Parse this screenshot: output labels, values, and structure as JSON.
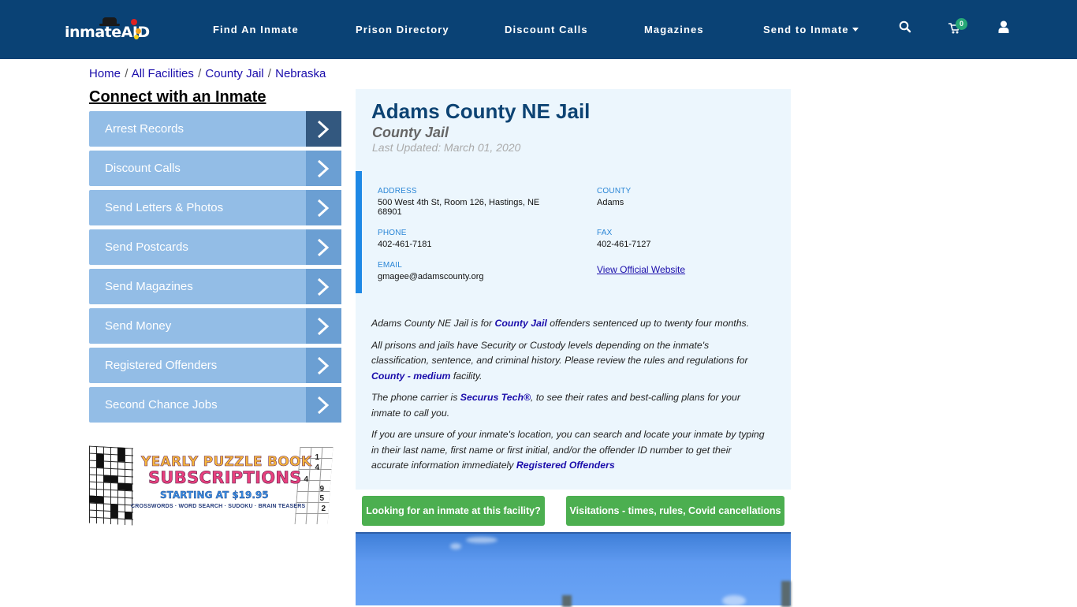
{
  "header": {
    "logo_text": "inmateAID",
    "nav": [
      {
        "label": "Find An Inmate"
      },
      {
        "label": "Prison Directory"
      },
      {
        "label": "Discount Calls"
      },
      {
        "label": "Magazines"
      },
      {
        "label": "Send to Inmate",
        "has_dropdown": true
      }
    ],
    "icons": [
      "search-icon",
      "cart-icon",
      "user-icon"
    ],
    "cart_count": "0"
  },
  "breadcrumb": [
    {
      "label": "Home"
    },
    {
      "label": "All Facilities"
    },
    {
      "label": "County Jail"
    },
    {
      "label": "Nebraska"
    }
  ],
  "breadcrumb_separator": "/",
  "sidebar": {
    "title": "Connect with an Inmate",
    "items": [
      {
        "label": "Arrest Records"
      },
      {
        "label": "Discount Calls"
      },
      {
        "label": "Send Letters & Photos"
      },
      {
        "label": "Send Postcards"
      },
      {
        "label": "Send Magazines"
      },
      {
        "label": "Send Money"
      },
      {
        "label": "Registered Offenders"
      },
      {
        "label": "Second Chance Jobs"
      }
    ],
    "ad": {
      "line1": "YEARLY PUZZLE BOOK",
      "line2": "SUBSCRIPTIONS",
      "line3": "STARTING AT $19.95",
      "line4": "CROSSWORDS · WORD SEARCH · SUDOKU · BRAIN TEASERS",
      "sudoku_numbers": [
        "1",
        "4",
        "4",
        "9",
        "5",
        "2"
      ]
    }
  },
  "facility": {
    "name": "Adams County NE Jail",
    "type": "County Jail",
    "last_updated": "Last Updated: March 01, 2020",
    "address_label": "ADDRESS",
    "address": "500 West 4th St, Room 126, Hastings, NE 68901",
    "county_label": "COUNTY",
    "county": "Adams",
    "phone_label": "PHONE",
    "phone": "402-461-7181",
    "fax_label": "FAX",
    "fax": "402-461-7127",
    "email_label": "EMAIL",
    "email": "gmagee@adamscounty.org",
    "website_link": "View Official Website"
  },
  "description": {
    "p1_pre": "Adams County NE Jail is for ",
    "p1_link": "County Jail",
    "p1_post": " offenders sentenced up to twenty four months.",
    "p2_pre": "All prisons and jails have Security or Custody levels depending on the inmate's classification, sentence, and criminal history. Please review the rules and regulations for ",
    "p2_link": "County - medium",
    "p2_post": " facility.",
    "p3_pre": "The phone carrier is ",
    "p3_link": "Securus Tech®",
    "p3_post": ", to see their rates and best-calling plans for your inmate to call you.",
    "p4_pre": "If you are unsure of your inmate's location, you can search and locate your inmate by typing in their last name, first name or first initial, and/or the offender ID number to get their accurate information immediately ",
    "p4_link": "Registered Offenders"
  },
  "buttons": {
    "find_inmate": "Looking for an inmate at this facility?",
    "visitations": "Visitations - times, rules, Covid cancellations"
  },
  "colors": {
    "header_bg": "#0a4275",
    "menu_bg": "#93bde6",
    "menu_arrow": "#6b9fd3",
    "menu_arrow_active": "#33587f",
    "panel_bg": "#ecf6fd",
    "accent_blue": "#1e88e5",
    "button_green": "#4caf50",
    "title_blue": "#0d4373",
    "link": "#1a0dab"
  }
}
